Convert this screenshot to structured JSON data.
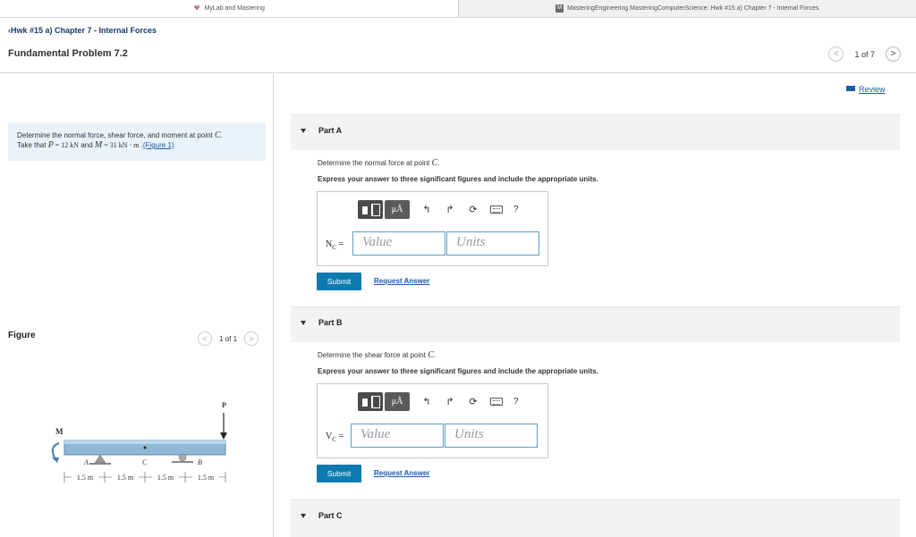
{
  "tabs": [
    {
      "icon": "asu-logo-icon",
      "label": "MyLab and Mastering"
    },
    {
      "icon": "mastering-logo-icon",
      "label": "MasteringEngineering MasteringComputerScience: Hwk #15 a) Chapter 7 - Internal Forces"
    }
  ],
  "header": {
    "back_link": "Hwk #15 a) Chapter 7 - Internal Forces",
    "title": "Fundamental Problem 7.2",
    "pager": {
      "prev": "<",
      "text": "1 of 7",
      "next": ">"
    }
  },
  "review": "Review",
  "problem": {
    "line1": "Determine the normal force, shear force, and moment at point ",
    "point": "C",
    "line1_end": ".",
    "take_that": "Take that ",
    "p_sym": "P",
    "p_val": " = 12 kN",
    "and": " and ",
    "m_sym": "M",
    "m_val": " = 31 kN · m",
    "figure_link": "(Figure 1)"
  },
  "figure": {
    "heading": "Figure",
    "pager": {
      "prev": "<",
      "text": "1 of 1",
      "next": ">"
    },
    "labels": {
      "P": "P",
      "M": "M",
      "A": "A",
      "C": "C",
      "B": "B",
      "dims": [
        "1.5 m",
        "1.5 m",
        "1.5 m",
        "1.5 m"
      ]
    }
  },
  "parts": [
    {
      "label": "Part A",
      "question": "Determine the normal force at point ",
      "point": "C",
      "instruction": "Express your answer to three significant figures and include the appropriate units.",
      "var": "N",
      "var_sub": "C",
      "eq": " =",
      "value_placeholder": "Value",
      "units_placeholder": "Units",
      "toolbar": {
        "mu": "μÅ",
        "undo": "↰",
        "redo": "↱",
        "reset": "⟳",
        "help": "?"
      },
      "submit": "Submit",
      "request": "Request Answer"
    },
    {
      "label": "Part B",
      "question": "Determine the shear force at point ",
      "point": "C",
      "instruction": "Express your answer to three significant figures and include the appropriate units.",
      "var": "V",
      "var_sub": "C",
      "eq": " =",
      "value_placeholder": "Value",
      "units_placeholder": "Units",
      "toolbar": {
        "mu": "μÅ",
        "undo": "↰",
        "redo": "↱",
        "reset": "⟳",
        "help": "?"
      },
      "submit": "Submit",
      "request": "Request Answer"
    },
    {
      "label": "Part C"
    }
  ]
}
